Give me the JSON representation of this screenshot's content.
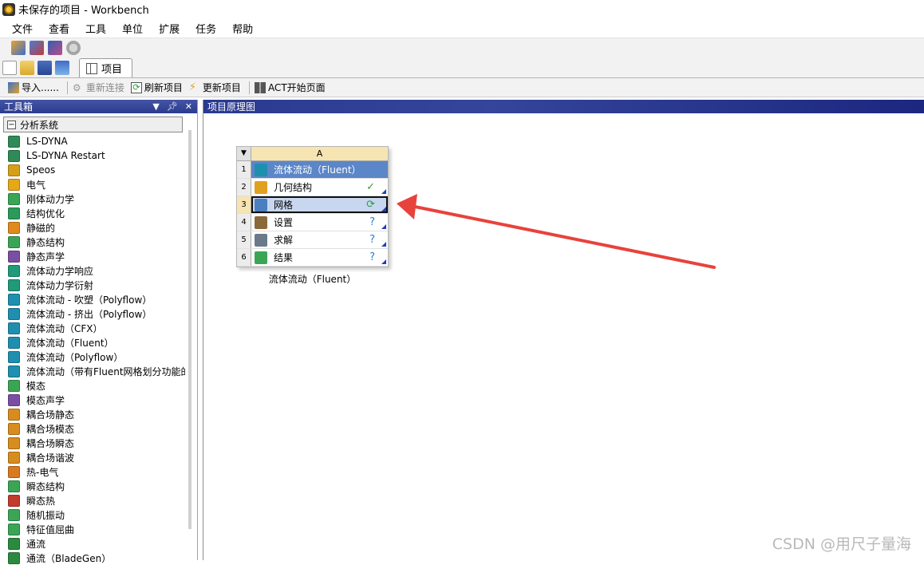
{
  "window": {
    "title": "未保存的项目 - Workbench"
  },
  "menu": [
    "文件",
    "查看",
    "工具",
    "单位",
    "扩展",
    "任务",
    "帮助"
  ],
  "tabs": [
    {
      "label": "项目"
    }
  ],
  "toolbar": {
    "import_label": "导入......",
    "reconnect_label": "重新连接",
    "refresh_label": "刷新项目",
    "update_label": "更新项目",
    "act_label": "ACT开始页面"
  },
  "toolbox": {
    "title": "工具箱",
    "group_label": "分析系统",
    "items": [
      {
        "label": "LS-DYNA",
        "color": "#2e8b57"
      },
      {
        "label": "LS-DYNA Restart",
        "color": "#2e8b57"
      },
      {
        "label": "Speos",
        "color": "#d4a017"
      },
      {
        "label": "电气",
        "color": "#e6a817"
      },
      {
        "label": "刚体动力学",
        "color": "#3aa655"
      },
      {
        "label": "结构优化",
        "color": "#2c9a5a"
      },
      {
        "label": "静磁的",
        "color": "#e08a1e"
      },
      {
        "label": "静态结构",
        "color": "#3aa655"
      },
      {
        "label": "静态声学",
        "color": "#7a4fa3"
      },
      {
        "label": "流体动力学响应",
        "color": "#1f9a7a"
      },
      {
        "label": "流体动力学衍射",
        "color": "#1f9a7a"
      },
      {
        "label": "流体流动 - 吹塑（Polyflow）",
        "color": "#1f8fb0"
      },
      {
        "label": "流体流动 - 挤出（Polyflow）",
        "color": "#1f8fb0"
      },
      {
        "label": "流体流动（CFX）",
        "color": "#1f8fb0"
      },
      {
        "label": "流体流动（Fluent）",
        "color": "#1f8fb0"
      },
      {
        "label": "流体流动（Polyflow）",
        "color": "#1f8fb0"
      },
      {
        "label": "流体流动（带有Fluent网格划分功能的",
        "color": "#1f8fb0"
      },
      {
        "label": "模态",
        "color": "#3aa655"
      },
      {
        "label": "模态声学",
        "color": "#7a4fa3"
      },
      {
        "label": "耦合场静态",
        "color": "#d98c1e"
      },
      {
        "label": "耦合场模态",
        "color": "#d98c1e"
      },
      {
        "label": "耦合场瞬态",
        "color": "#d98c1e"
      },
      {
        "label": "耦合场谐波",
        "color": "#d98c1e"
      },
      {
        "label": "热-电气",
        "color": "#d97a1e"
      },
      {
        "label": "瞬态结构",
        "color": "#3aa655"
      },
      {
        "label": "瞬态热",
        "color": "#c43b2b"
      },
      {
        "label": "随机振动",
        "color": "#3aa655"
      },
      {
        "label": "特征值屈曲",
        "color": "#3aa655"
      },
      {
        "label": "通流",
        "color": "#2b8a3e"
      },
      {
        "label": "通流（BladeGen）",
        "color": "#2b8a3e"
      }
    ]
  },
  "schematic": {
    "title": "项目原理图",
    "system": {
      "column_label": "A",
      "caption": "流体流动（Fluent）",
      "rows": [
        {
          "num": "1",
          "label": "流体流动（Fluent）",
          "status": "",
          "icon_color": "#1f8fb0"
        },
        {
          "num": "2",
          "label": "几何结构",
          "status": "✓",
          "status_color": "#3a9a2a",
          "icon_color": "#e0a020"
        },
        {
          "num": "3",
          "label": "网格",
          "status": "⟳",
          "status_color": "#2e9a3e",
          "icon_color": "#4a7fc0"
        },
        {
          "num": "4",
          "label": "设置",
          "status": "?",
          "status_color": "#2a7fd0",
          "icon_color": "#8a6a3a"
        },
        {
          "num": "5",
          "label": "求解",
          "status": "?",
          "status_color": "#2a7fd0",
          "icon_color": "#6a7a8a"
        },
        {
          "num": "6",
          "label": "结果",
          "status": "?",
          "status_color": "#2a7fd0",
          "icon_color": "#3aa655"
        }
      ]
    }
  },
  "annotation": {
    "arrow_color": "#e8423c"
  },
  "watermark": "CSDN @用尺子量海"
}
